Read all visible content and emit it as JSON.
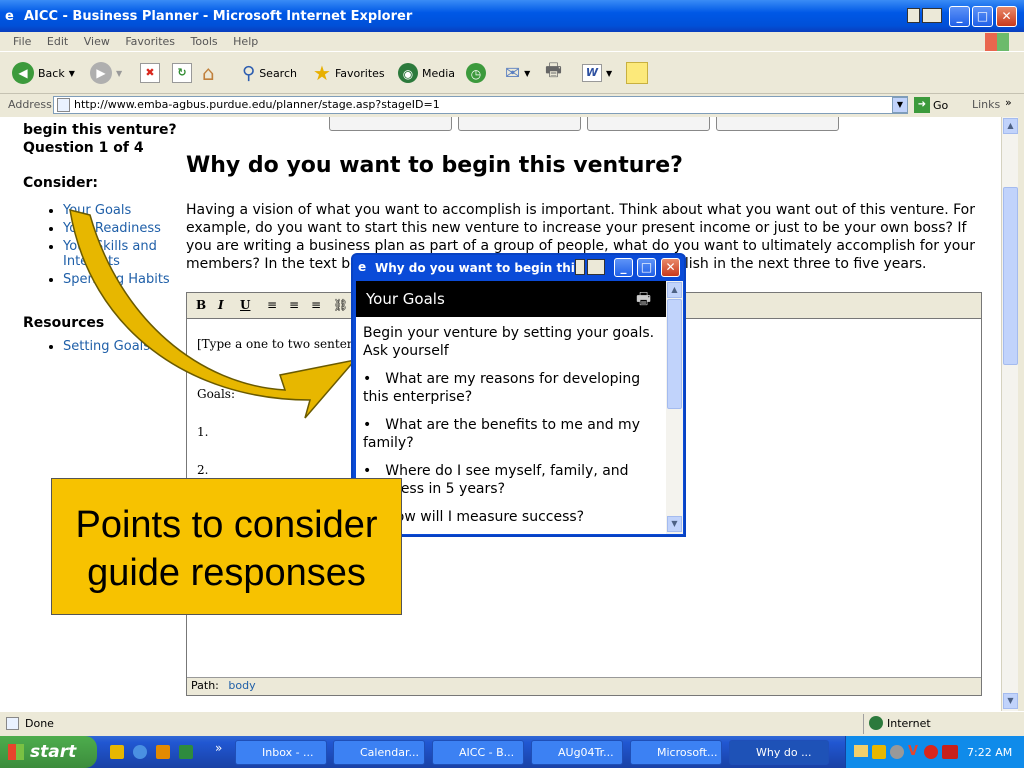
{
  "window": {
    "title": "AICC - Business Planner - Microsoft Internet Explorer",
    "min": "_",
    "max": "□",
    "close": "✕"
  },
  "menu": [
    "File",
    "Edit",
    "View",
    "Favorites",
    "Tools",
    "Help"
  ],
  "toolbar": {
    "back": "Back",
    "search": "Search",
    "favorites": "Favorites",
    "media": "Media"
  },
  "address": {
    "label": "Address",
    "url": "http://www.emba-agbus.purdue.edu/planner/stage.asp?stageID=1",
    "go": "Go",
    "links": "Links"
  },
  "sidebar": {
    "title_partial": "begin this venture?",
    "question": "Question 1 of 4",
    "consider_heading": "Consider:",
    "consider_items": [
      "Your Goals",
      "Your Readiness",
      "Your Skills and Interests",
      "Spending Habits"
    ],
    "resources_heading": "Resources",
    "resource_items": [
      "Setting Goals"
    ]
  },
  "main": {
    "heading": "Why do you want to begin this venture?",
    "intro": "Having a vision of what you want to accomplish is important. Think about what you want out of this venture. For example, do you want to start this new venture to increase your present income or just to be your own boss? If you are writing a business plan as part of a group of people, what do you want to ultimately accomplish for your members? In the text box below, summarize what you want to accomplish in the next three to five years."
  },
  "editor": {
    "bold": "B",
    "italic": "I",
    "underline": "U",
    "line1": "[Type a one to two sentence",
    "goals": "Goals:",
    "item1": "1.",
    "item2": "2.",
    "path_label": "Path:",
    "path_value": "body"
  },
  "popup": {
    "title": "Why do you want to begin this v",
    "header": "Your Goals",
    "intro": "Begin your venture by setting your goals. Ask yourself",
    "bullets": [
      "What are my reasons for developing this enterprise?",
      "What are the benefits to me and my family?",
      "Where do I see myself, family, and business in 5 years?",
      "How will I measure success?"
    ]
  },
  "callout": {
    "text": "Points to consider guide responses"
  },
  "status": {
    "text": "Done",
    "zone": "Internet"
  },
  "taskbar": {
    "start": "start",
    "tasks": [
      "Inbox - ...",
      "Calendar...",
      "AICC - B...",
      "AUg04Tr...",
      "Microsoft...",
      "Why do ..."
    ],
    "clock": "7:22 AM"
  },
  "colors": {
    "xp_blue": "#0058E6",
    "callout": "#F7C200",
    "link": "#1F5FA8"
  }
}
